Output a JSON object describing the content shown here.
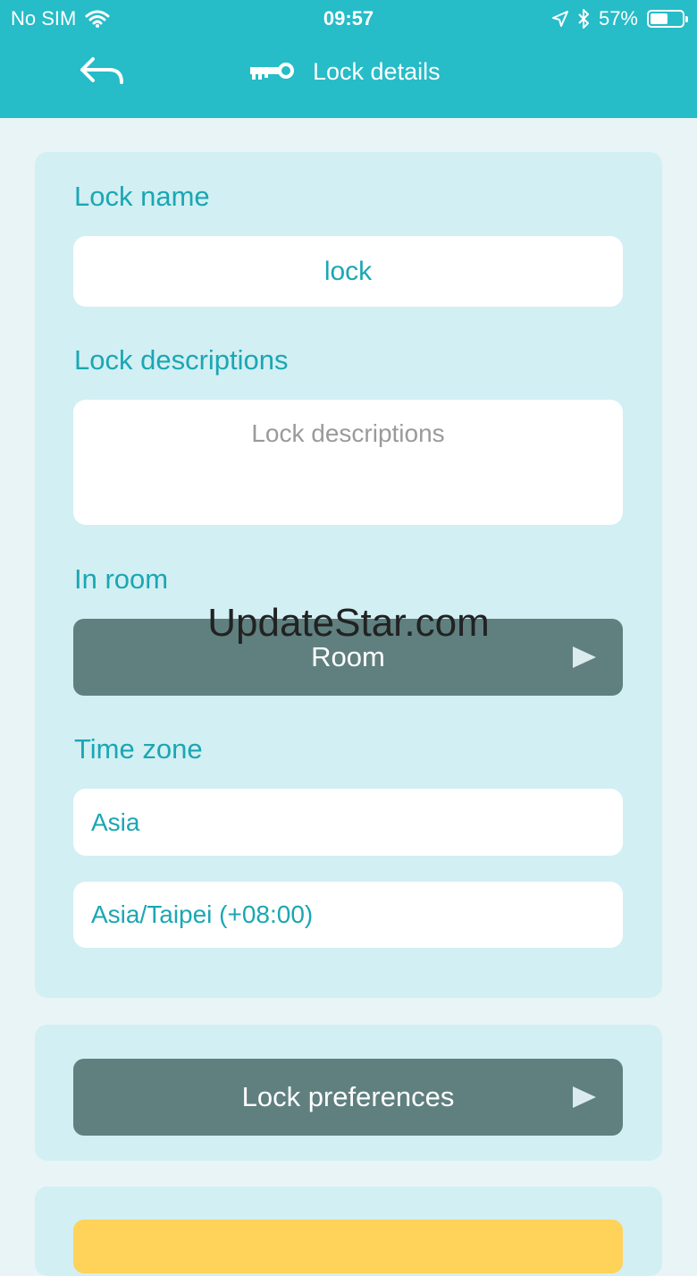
{
  "status_bar": {
    "carrier": "No SIM",
    "time": "09:57",
    "battery_percent_label": "57%",
    "battery_level": 0.57
  },
  "header": {
    "title": "Lock details",
    "back_icon": "back-arrow-icon",
    "title_icon": "key-icon"
  },
  "form": {
    "lock_name_label": "Lock name",
    "lock_name_value": "lock",
    "lock_descriptions_label": "Lock descriptions",
    "lock_descriptions_placeholder": "Lock descriptions",
    "in_room_label": "In room",
    "room_button_label": "Room",
    "time_zone_label": "Time zone",
    "time_zone_region": "Asia",
    "time_zone_value": "Asia/Taipei (+08:00)"
  },
  "preferences": {
    "button_label": "Lock preferences"
  },
  "watermark": "UpdateStar.com",
  "colors": {
    "header_bg": "#26bcc8",
    "page_bg": "#e8f4f6",
    "card_bg": "#d2eff3",
    "accent_text": "#1aa7b3",
    "dark_button": "#608080",
    "yellow_button": "#ffd25a"
  }
}
